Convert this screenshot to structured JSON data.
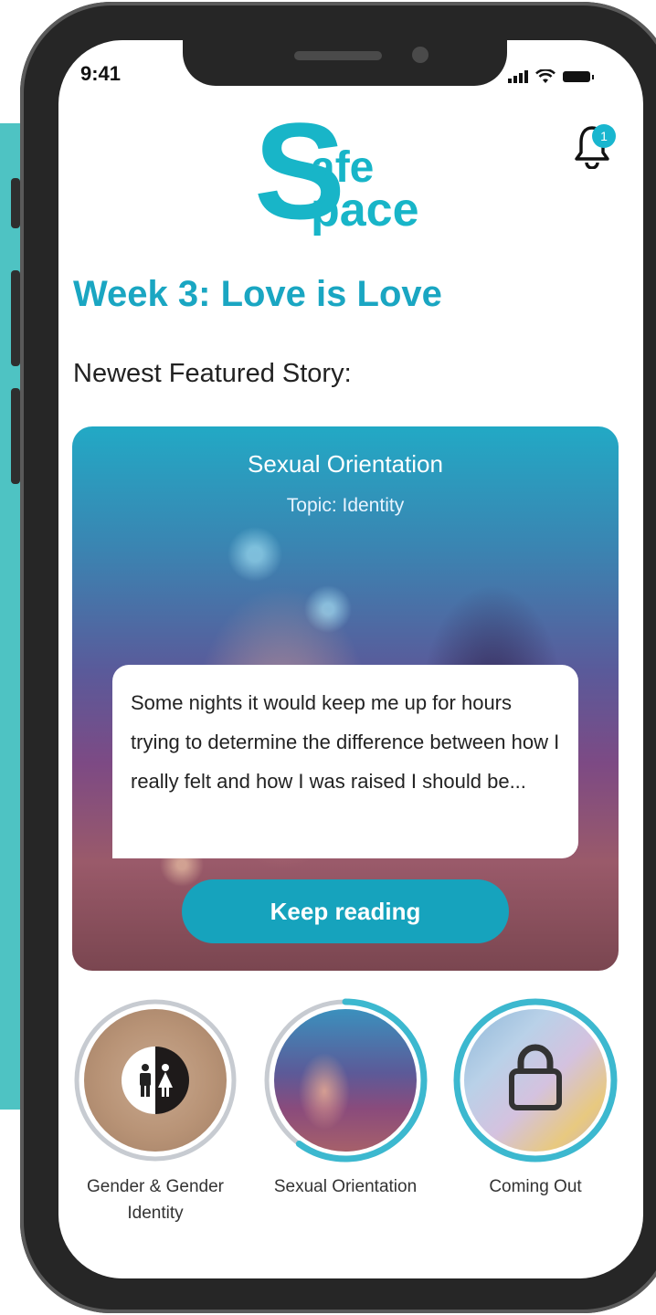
{
  "status_bar": {
    "time": "9:41"
  },
  "header": {
    "logo_first_letter": "S",
    "logo_line1": "afe",
    "logo_line2": "pace",
    "notification_count": "1"
  },
  "main": {
    "week_title": "Week 3: Love is Love",
    "featured_label": "Newest Featured Story:",
    "story": {
      "title": "Sexual Orientation",
      "topic": "Topic: Identity",
      "excerpt": "Some nights it would keep me up for hours trying to determine the difference between how I really felt and how I was raised I should be...",
      "cta_label": "Keep reading"
    },
    "topics": [
      {
        "label": "Gender & Gender Identity",
        "progress": 0.0
      },
      {
        "label": "Sexual Orientation",
        "progress": 0.6
      },
      {
        "label": "Coming Out",
        "progress": 1.0,
        "locked": true
      }
    ]
  },
  "colors": {
    "accent": "#19b6cf",
    "title": "#1aa6c2",
    "button": "#16a3bd"
  }
}
